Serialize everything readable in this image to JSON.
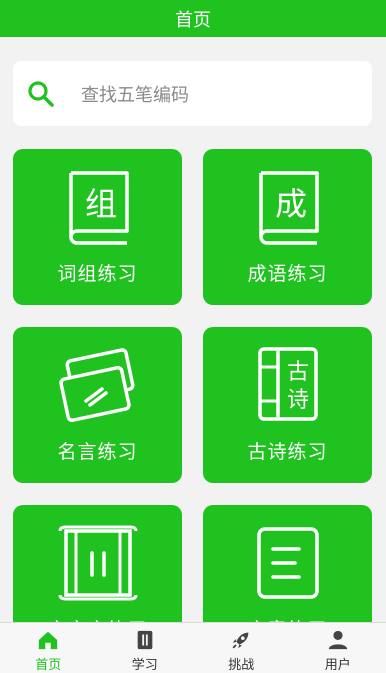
{
  "header": {
    "title": "首页"
  },
  "search": {
    "placeholder": "查找五笔编码",
    "icon": "search-icon"
  },
  "cards": [
    {
      "label": "词组练习",
      "icon_char": "组",
      "icon": "book-icon"
    },
    {
      "label": "成语练习",
      "icon_char": "成",
      "icon": "book-icon"
    },
    {
      "label": "名言练习",
      "icon": "cards-icon"
    },
    {
      "label": "古诗练习",
      "icon_chars": [
        "古",
        "诗"
      ],
      "icon": "poem-book-icon"
    },
    {
      "label": "文言文练习",
      "icon": "scroll-icon"
    },
    {
      "label": "文章练习",
      "icon": "document-icon"
    }
  ],
  "tabbar": {
    "items": [
      {
        "label": "首页",
        "icon": "home-icon",
        "active": true
      },
      {
        "label": "学习",
        "icon": "notebook-icon",
        "active": false
      },
      {
        "label": "挑战",
        "icon": "rocket-icon",
        "active": false
      },
      {
        "label": "用户",
        "icon": "user-icon",
        "active": false
      }
    ]
  },
  "colors": {
    "accent": "#1fc21f",
    "background": "#f2f2f2"
  }
}
